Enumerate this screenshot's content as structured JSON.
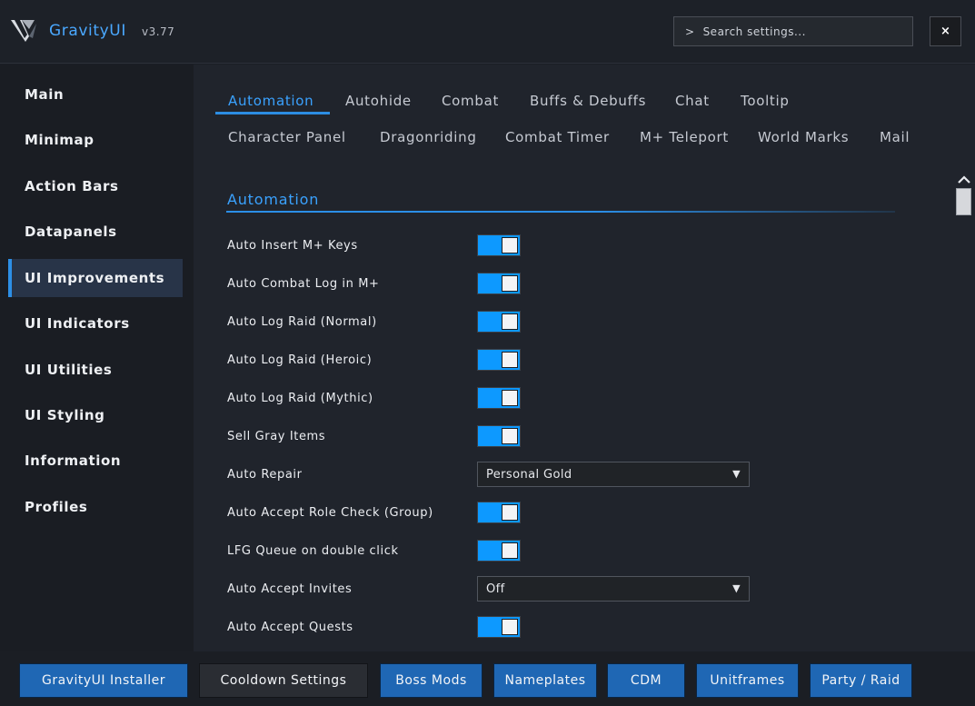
{
  "app": {
    "name": "GravityUI",
    "version": "v3.77",
    "logo_icon": "gravityui-logo-icon"
  },
  "search": {
    "prompt": ">",
    "placeholder": "Search settings..."
  },
  "close_label": "×",
  "sidebar": {
    "items": [
      {
        "label": "Main",
        "active": false
      },
      {
        "label": "Minimap",
        "active": false
      },
      {
        "label": "Action Bars",
        "active": false
      },
      {
        "label": "Datapanels",
        "active": false
      },
      {
        "label": "UI Improvements",
        "active": true
      },
      {
        "label": "UI Indicators",
        "active": false
      },
      {
        "label": "UI Utilities",
        "active": false
      },
      {
        "label": "UI Styling",
        "active": false
      },
      {
        "label": "Information",
        "active": false
      },
      {
        "label": "Profiles",
        "active": false
      }
    ]
  },
  "tabs": {
    "row1": [
      "Automation",
      "Autohide",
      "Combat",
      "Buffs & Debuffs",
      "Chat",
      "Tooltip"
    ],
    "row2": [
      "Character Panel",
      "Dragonriding",
      "Combat Timer",
      "M+ Teleport",
      "World Marks",
      "Mail"
    ],
    "active": "Automation"
  },
  "section": {
    "title": "Automation",
    "settings": [
      {
        "label": "Auto Insert M+ Keys",
        "type": "toggle",
        "value": true
      },
      {
        "label": "Auto Combat Log in M+",
        "type": "toggle",
        "value": true
      },
      {
        "label": "Auto Log Raid (Normal)",
        "type": "toggle",
        "value": true
      },
      {
        "label": "Auto Log Raid (Heroic)",
        "type": "toggle",
        "value": true
      },
      {
        "label": "Auto Log Raid (Mythic)",
        "type": "toggle",
        "value": true
      },
      {
        "label": "Sell Gray Items",
        "type": "toggle",
        "value": true
      },
      {
        "label": "Auto Repair",
        "type": "dropdown",
        "value": "Personal Gold"
      },
      {
        "label": "Auto Accept Role Check (Group)",
        "type": "toggle",
        "value": true
      },
      {
        "label": "LFG Queue on double click",
        "type": "toggle",
        "value": true
      },
      {
        "label": "Auto Accept Invites",
        "type": "dropdown",
        "value": "Off"
      },
      {
        "label": "Auto Accept Quests",
        "type": "toggle",
        "value": true
      }
    ]
  },
  "footer": {
    "buttons": [
      {
        "label": "GravityUI Installer",
        "style": "blue"
      },
      {
        "label": "Cooldown Settings",
        "style": "dark"
      },
      {
        "label": "Boss Mods",
        "style": "blue"
      },
      {
        "label": "Nameplates",
        "style": "blue"
      },
      {
        "label": "CDM",
        "style": "blue"
      },
      {
        "label": "Unitframes",
        "style": "blue"
      },
      {
        "label": "Party / Raid",
        "style": "blue"
      }
    ]
  },
  "colors": {
    "accent": "#3aa2ff",
    "toggle_on": "#0d99ff",
    "button_blue": "#1f67b4"
  }
}
